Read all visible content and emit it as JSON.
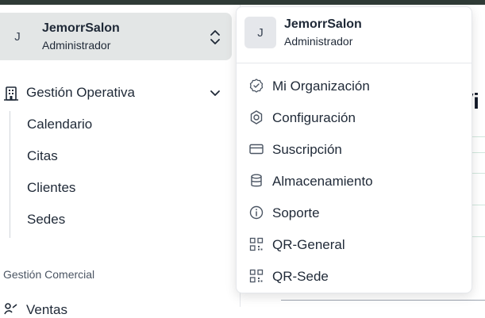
{
  "account": {
    "initial": "J",
    "name": "JemorrSalon",
    "role": "Administrador"
  },
  "sidebar": {
    "group": {
      "label": "Gestión Operativa",
      "icon": "building-icon",
      "items": [
        {
          "label": "Calendario"
        },
        {
          "label": "Citas"
        },
        {
          "label": "Clientes"
        },
        {
          "label": "Sedes"
        }
      ]
    },
    "section_title": "Gestión Comercial",
    "next_item": {
      "label": "Ventas",
      "icon": "sales-icon"
    }
  },
  "main": {
    "partial_title": "Vi"
  },
  "dropdown": {
    "initial": "J",
    "name": "JemorrSalon",
    "role": "Administrador",
    "items": [
      {
        "label": "Mi Organización",
        "icon": "badge-check-icon"
      },
      {
        "label": "Configuración",
        "icon": "settings-icon"
      },
      {
        "label": "Suscripción",
        "icon": "credit-card-icon"
      },
      {
        "label": "Almacenamiento",
        "icon": "database-icon"
      },
      {
        "label": "Soporte",
        "icon": "info-icon"
      },
      {
        "label": "QR-General",
        "icon": "qr-icon"
      },
      {
        "label": "QR-Sede",
        "icon": "qr-icon"
      }
    ]
  }
}
